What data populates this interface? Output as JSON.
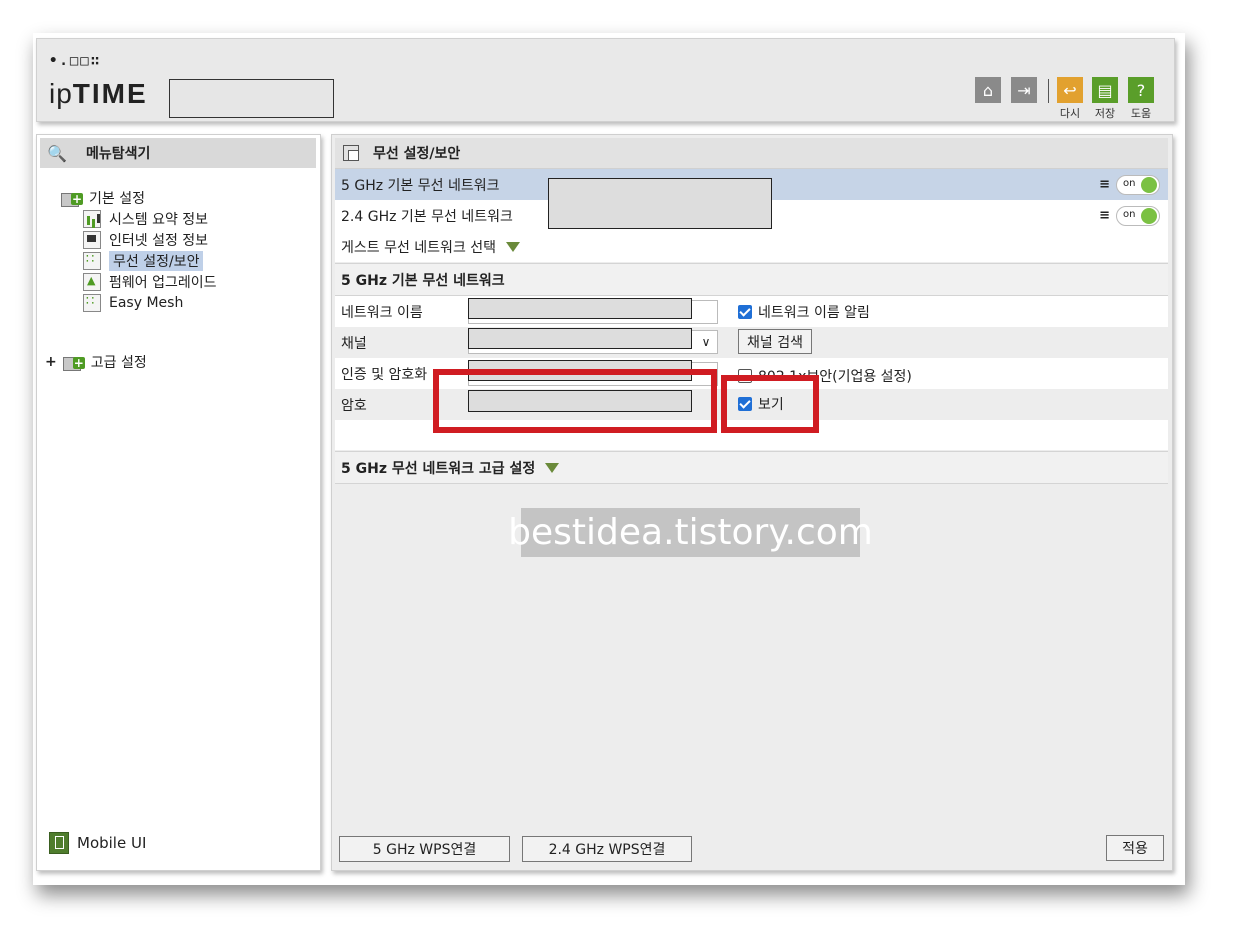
{
  "header": {
    "logo_dots": "•.□□∷",
    "logo_prefix": "ip",
    "logo_brand": "TIME",
    "buttons": {
      "home_icon": "home-icon",
      "logout_icon": "logout-icon",
      "undo_label": "다시",
      "save_label": "저장",
      "help_label": "도움"
    }
  },
  "sidebar": {
    "title": "메뉴탐색기",
    "basic": {
      "label": "기본 설정",
      "items": [
        {
          "label": "시스템 요약 정보",
          "icon": "chart-icon"
        },
        {
          "label": "인터넷 설정 정보",
          "icon": "network-icon"
        },
        {
          "label": "무선 설정/보안",
          "icon": "wireless-icon",
          "selected": true
        },
        {
          "label": "펌웨어 업그레이드",
          "icon": "upgrade-icon"
        },
        {
          "label": "Easy Mesh",
          "icon": "mesh-icon"
        }
      ]
    },
    "advanced": {
      "expand": "+",
      "label": "고급 설정"
    },
    "mobile_ui": "Mobile UI"
  },
  "main": {
    "title": "무선 설정/보안",
    "networks": [
      {
        "label": "5 GHz 기본 무선 네트워크",
        "toggle": "on"
      },
      {
        "label": "2.4 GHz 기본 무선 네트워크",
        "toggle": "on"
      }
    ],
    "guest_label": "게스트 무선 네트워크 선택",
    "section_5g": "5 GHz 기본 무선 네트워크",
    "form": {
      "network_name_label": "네트워크 이름",
      "broadcast_label": "네트워크 이름 알림",
      "channel_label": "채널",
      "channel_search": "채널 검색",
      "auth_label": "인증 및 암호화",
      "enterprise_label": "802.1x보안(기업용 설정)",
      "password_label": "암호",
      "show_label": "보기"
    },
    "advanced_section": "5 GHz 무선 네트워크 고급 설정",
    "watermark": "bestidea.tistory.com",
    "buttons": {
      "wps_5g": "5 GHz WPS연결",
      "wps_24g": "2.4 GHz WPS연결",
      "apply": "적용"
    }
  },
  "colors": {
    "brand_green": "#6aaa2c",
    "highlight": "#c6d4e7",
    "annotation_red": "#d01c22",
    "toggle_green": "#7bc143"
  }
}
